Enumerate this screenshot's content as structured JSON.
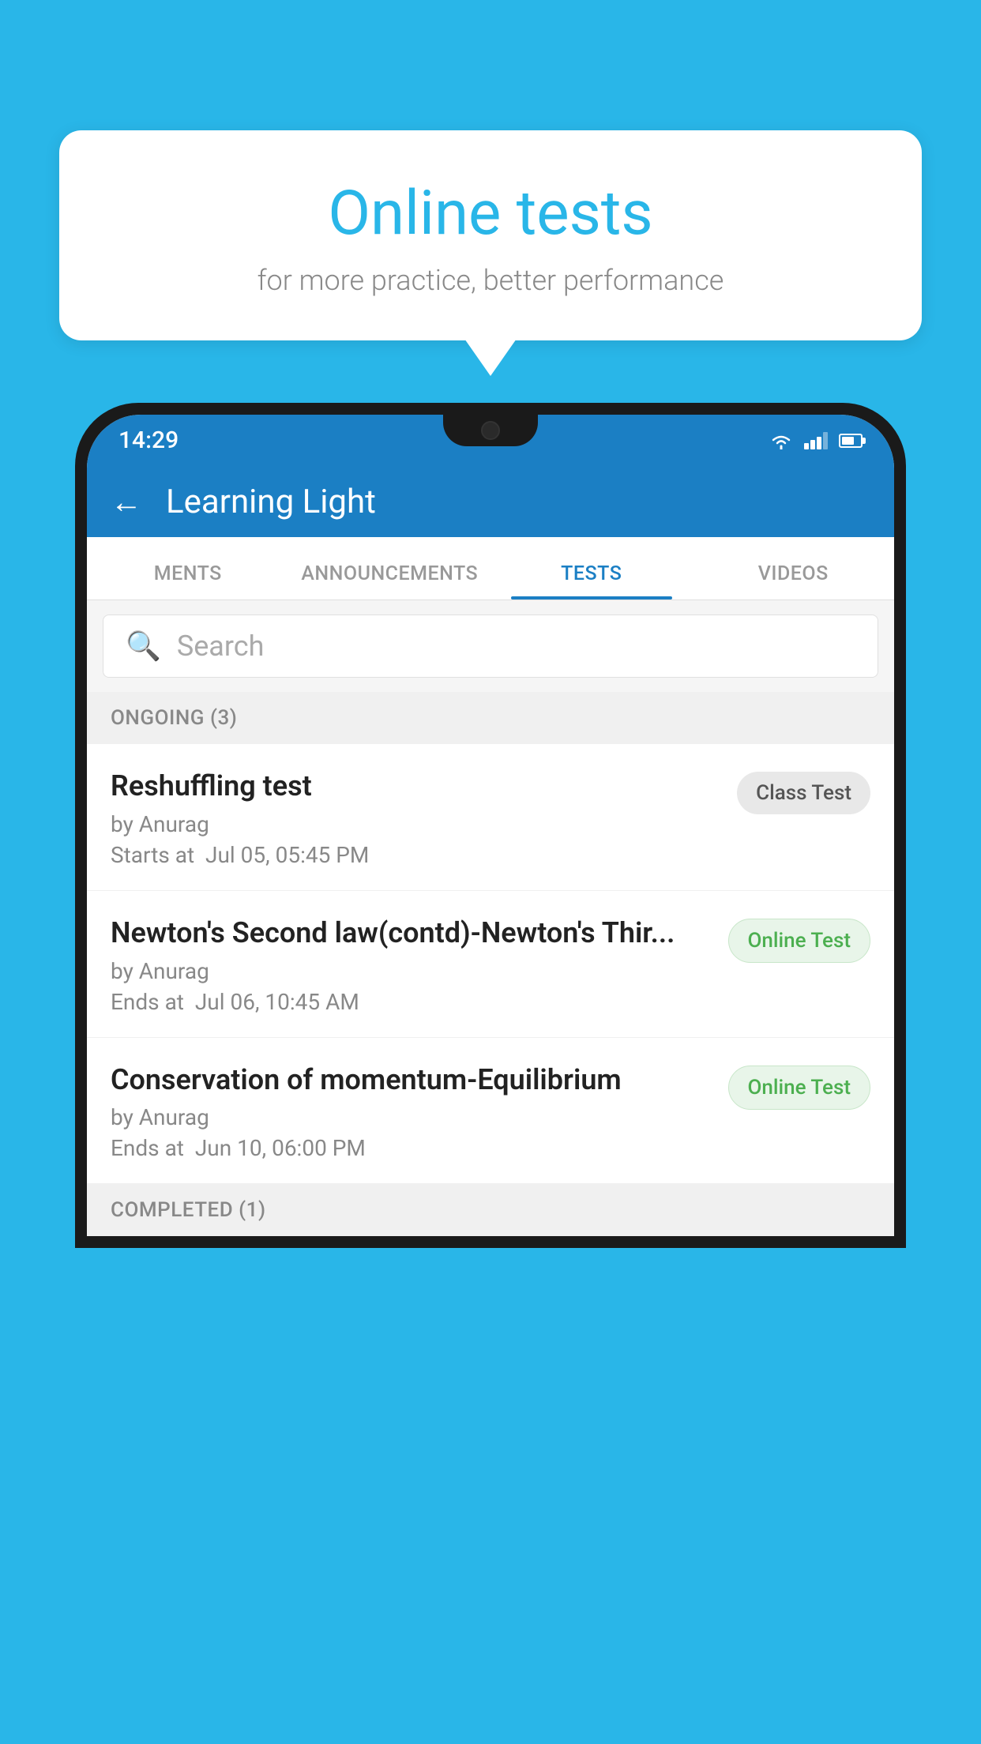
{
  "background_color": "#29b6e8",
  "bubble": {
    "title": "Online tests",
    "subtitle": "for more practice, better performance"
  },
  "phone": {
    "status_bar": {
      "time": "14:29",
      "icons": [
        "wifi",
        "signal",
        "battery"
      ]
    },
    "header": {
      "back_label": "←",
      "title": "Learning Light"
    },
    "tabs": [
      {
        "label": "MENTS",
        "active": false
      },
      {
        "label": "ANNOUNCEMENTS",
        "active": false
      },
      {
        "label": "TESTS",
        "active": true
      },
      {
        "label": "VIDEOS",
        "active": false
      }
    ],
    "search": {
      "placeholder": "Search"
    },
    "ongoing_section": {
      "label": "ONGOING (3)"
    },
    "tests": [
      {
        "name": "Reshuffling test",
        "by": "by Anurag",
        "time_label": "Starts at",
        "time": "Jul 05, 05:45 PM",
        "badge": "Class Test",
        "badge_type": "class"
      },
      {
        "name": "Newton's Second law(contd)-Newton's Thir...",
        "by": "by Anurag",
        "time_label": "Ends at",
        "time": "Jul 06, 10:45 AM",
        "badge": "Online Test",
        "badge_type": "online"
      },
      {
        "name": "Conservation of momentum-Equilibrium",
        "by": "by Anurag",
        "time_label": "Ends at",
        "time": "Jun 10, 06:00 PM",
        "badge": "Online Test",
        "badge_type": "online"
      }
    ],
    "completed_section": {
      "label": "COMPLETED (1)"
    }
  }
}
